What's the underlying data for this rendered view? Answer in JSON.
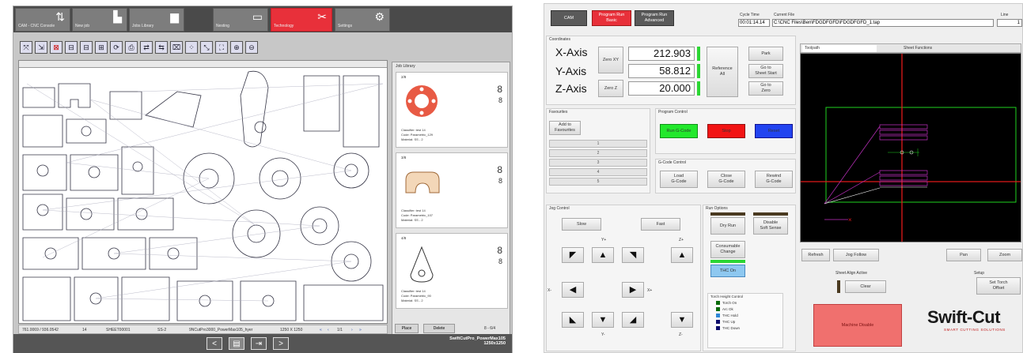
{
  "left": {
    "tabs": [
      {
        "label": "CAM - CNC Console",
        "icon": "arrows-icon"
      },
      {
        "label": "New job",
        "icon": "doc-plus-icon"
      },
      {
        "label": "Jobs Library",
        "icon": "doc-icon"
      },
      {
        "label": "Nesting",
        "icon": "nesting-icon"
      },
      {
        "label": "Technology",
        "icon": "scissors-icon"
      },
      {
        "label": "Settings",
        "icon": "gear-icon"
      }
    ],
    "toolbar_icons": [
      "part-icon",
      "part-icon",
      "part-icon",
      "align-icon",
      "align-icon",
      "align-icon",
      "rotate-icon",
      "print-icon",
      "nest-icon",
      "nest-icon",
      "clear-icon",
      "grid-icon",
      "select-icon",
      "fit-icon",
      "zoom-in-icon",
      "zoom-out-icon"
    ],
    "library_title": "Job Library",
    "cards": [
      {
        "count": "2/8",
        "qty1": "8",
        "qty2": "8",
        "classifier": "Classifier:  test 14",
        "code": "Code:        Parametric_129",
        "material": "Material:    SS - 2"
      },
      {
        "count": "3/8",
        "qty1": "8",
        "qty2": "8",
        "classifier": "Classifier:  test 14",
        "code": "Code:        Parametric_107",
        "material": "Material:    SS - 2"
      },
      {
        "count": "4/8",
        "qty1": "8",
        "qty2": "8",
        "classifier": "Classifier:  test 14",
        "code": "Code:        Parametric_90",
        "material": "Material:    SS - 2"
      }
    ],
    "status": {
      "coords": "761.0069 / 936.0542",
      "qty": "14",
      "sheet": "SHEET00001",
      "mat": "SS-2",
      "file": "9NCutPro3000_PowerMax105_hyer",
      "size": "1250 X 1250",
      "page": "1/1"
    },
    "place": "Place",
    "delete": "Delete",
    "lib_count": "8 - 6/4",
    "machine": "SwiftCutPro_PowerMax105",
    "sheet_size": "1250x1250",
    "bottom_icons": [
      "prev-icon",
      "doc-icon",
      "export-icon",
      "next-icon"
    ]
  },
  "right": {
    "cam": "CAM",
    "run_basic": "Program Run\nBasic",
    "run_adv": "Program Run\nAdvanced",
    "cycle_label": "Cycle Time",
    "cycle_val": "00:01:14.14",
    "file_label": "Current File",
    "file_val": "C:\\CNC Files\\Ben\\FDGDFGFD\\FDGDFGFD_1.tap",
    "line_label": "Line",
    "line_val": "1",
    "coord_title": "Coordinates",
    "x_label": "X-Axis",
    "x_val": "212.903",
    "y_label": "Y-Axis",
    "y_val": "58.812",
    "z_label": "Z-Axis",
    "z_val": "20.000",
    "zero_xy": "Zero XY",
    "zero_z": "Zero Z",
    "ref_all": "Reference\nAll",
    "park": "Park",
    "goto_start": "Go to\nSheet Start",
    "goto_zero": "Go to\nZero",
    "tab_toolpath": "Toolpath",
    "tab_sheet": "Sheet Functions",
    "fav_title": "Favourites",
    "add_fav": "Add to\nFavourites",
    "favs": [
      "1",
      "2",
      "3",
      "4",
      "5"
    ],
    "prog_title": "Program Control",
    "run_gcode": "Run G-Code",
    "stop": "Stop",
    "reset": "Reset",
    "gcode_title": "G-Code Control",
    "load": "Load\nG-Code",
    "close": "Close\nG-Code",
    "rewind": "Rewind\nG-Code",
    "jog_title": "Jog Control",
    "slow": "Slow",
    "fast": "Fast",
    "yplus": "Y+",
    "yminus": "Y-",
    "xminus": "X-",
    "xplus": "X+",
    "zplus": "Z+",
    "zminus": "Z-",
    "runopt_title": "Run Options",
    "dry_run": "Dry Run",
    "disable_soft": "Disable\nSoft Sense",
    "consumable": "Consumable\nChange",
    "thc_on": "THC On",
    "thc_title": "Torch Height Control",
    "thc_items": [
      {
        "label": "Torch On",
        "color": "#0a6b0a"
      },
      {
        "label": "Arc Ok",
        "color": "#0a6b0a"
      },
      {
        "label": "THC Hold",
        "color": "#2d86d6"
      },
      {
        "label": "THC Up",
        "color": "#0b0b6b"
      },
      {
        "label": "THC Down",
        "color": "#0b0b6b"
      }
    ],
    "refresh": "Refresh",
    "jog_follow": "Jog Follow",
    "pan": "Pan",
    "zoom": "Zoom",
    "sheet_align": "Sheet Align Active",
    "clear": "Clear",
    "setup": "Setup",
    "set_torch": "Set Torch\nOffset",
    "machine_disable": "Machine Disable",
    "logo": "Swift-Cut",
    "logo_sub": "SMART CUTTING SOLUTIONS"
  }
}
